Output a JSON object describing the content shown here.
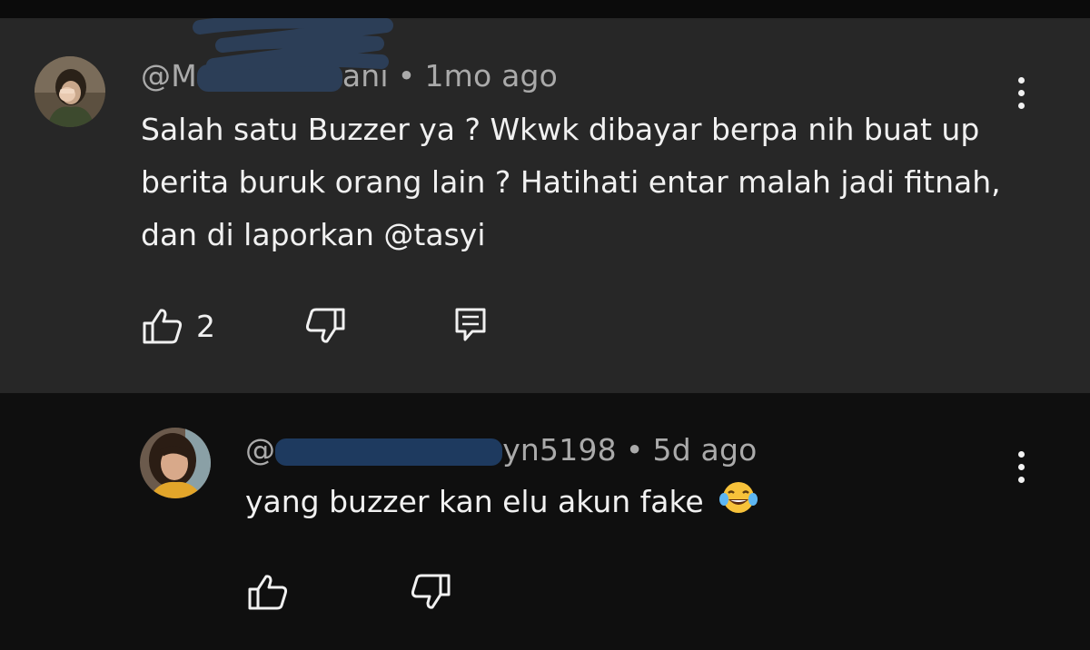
{
  "comments": [
    {
      "handle_prefix": "@M",
      "handle_suffix": "ani",
      "time": "1mo ago",
      "text": "Salah satu Buzzer ya ? Wkwk dibayar berpa nih buat up berita buruk orang lain ? Hatihati entar malah jadi fitnah, dan di laporkan @tasyi",
      "like_count": "2",
      "avatar_icon": "user-avatar-icon",
      "colors": {
        "background": "#272727",
        "redaction": "#2c3e57"
      }
    },
    {
      "handle_prefix": "@",
      "handle_suffix": "yn5198",
      "time": "5d ago",
      "text": "yang buzzer kan elu akun fake",
      "emoji": "😂",
      "avatar_icon": "user-avatar-icon",
      "colors": {
        "background": "#0f0f0f",
        "redaction": "#1e3a5f"
      }
    }
  ],
  "ui": {
    "separator": "•",
    "like_icon": "thumbs-up-icon",
    "dislike_icon": "thumbs-down-icon",
    "reply_icon": "reply-icon",
    "more_icon": "more-vertical-icon"
  }
}
